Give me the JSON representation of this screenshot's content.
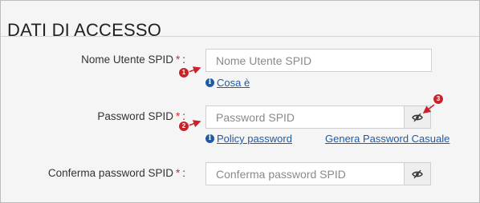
{
  "section": {
    "title": "DATI DI ACCESSO"
  },
  "fields": [
    {
      "label": "Nome Utente SPID",
      "required_mark": "*",
      "colon": ":",
      "placeholder": "Nome Utente SPID"
    },
    {
      "label": "Password SPID",
      "required_mark": "*",
      "colon": ":",
      "placeholder": "Password SPID"
    },
    {
      "label": "Conferma password SPID",
      "required_mark": "*",
      "colon": ":",
      "placeholder": "Conferma password SPID"
    }
  ],
  "links": {
    "info_glyph": "i",
    "cosa_e": "Cosa è",
    "policy_password": "Policy password",
    "genera_password": "Genera Password Casuale"
  },
  "callouts": [
    "1",
    "2",
    "3"
  ],
  "colors": {
    "accent_link": "#1f5aa6",
    "required": "#d9282f",
    "callout": "#c8232b"
  }
}
